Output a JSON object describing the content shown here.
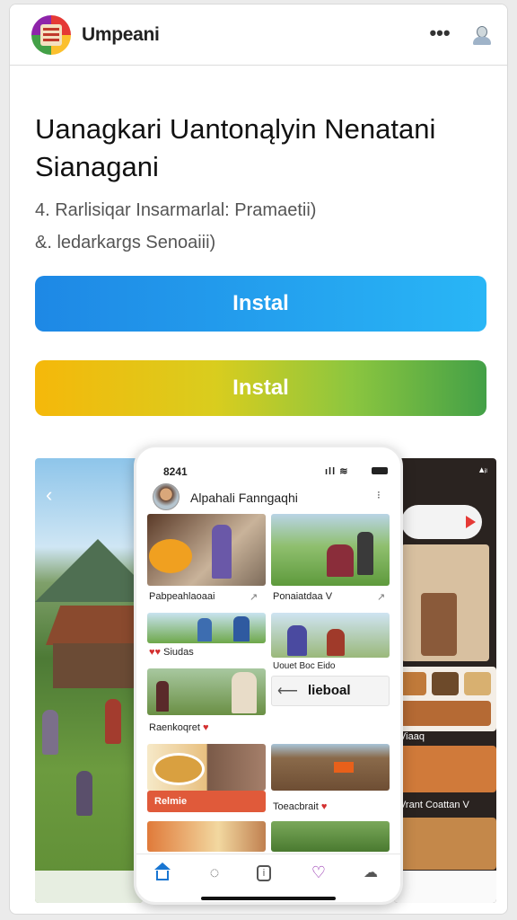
{
  "app": {
    "name": "Umpeani"
  },
  "icons": [
    "app-logo-icon",
    "more-icon",
    "profile-icon",
    "home-icon",
    "chat-icon",
    "info-icon",
    "heart-icon",
    "notifications-icon"
  ],
  "header": {
    "title": "Uanagkari Uantonąlyin Nenatani Sianagani",
    "line1": "4. Rarlisiqar Insarmarlal: Pramaetii)",
    "line2": "&. ledarkargs Senoaiii)"
  },
  "buttons": {
    "install_primary": "Instal",
    "install_secondary": "Instal"
  },
  "colors": {
    "primary_blue": "#1e88e5",
    "gradient_start": "#f5b80a",
    "gradient_end": "#43a047",
    "heart_red": "#d32f2f"
  },
  "phone": {
    "time": "8241",
    "profile_name": "Alpahali Fanngaqhi",
    "posts": [
      {
        "caption": "Pabpeahlaoaai"
      },
      {
        "caption": "Ponaiatdaa V"
      },
      {
        "caption": "Siudas"
      },
      {
        "caption": "Uouet Boc Eido"
      },
      {
        "caption": "lieboal"
      },
      {
        "caption": "Raenkoqret"
      },
      {
        "caption": "Relmie"
      },
      {
        "caption": "Toeacbrait"
      }
    ]
  },
  "right_panel": {
    "captions": [
      "Viaaq",
      "Vrant Coattan V"
    ]
  }
}
